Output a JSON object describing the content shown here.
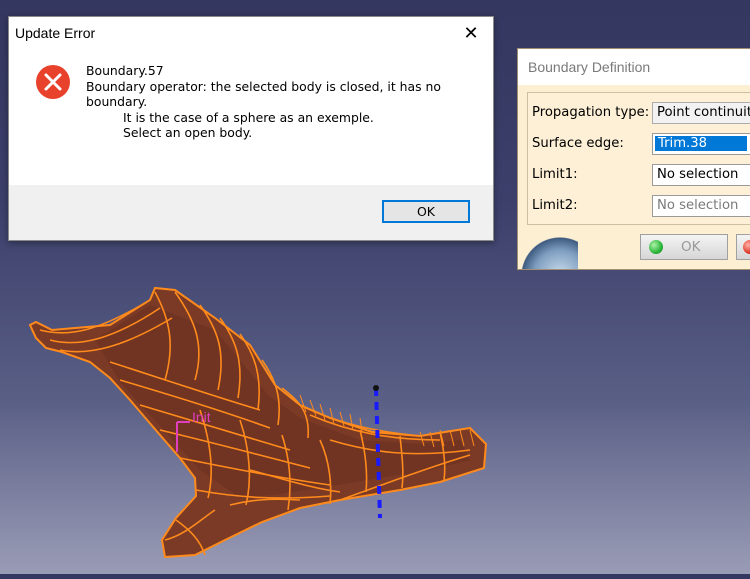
{
  "update_error": {
    "title": "Update Error",
    "message_line1": "Boundary.57",
    "message_line2": "Boundary operator: the selected body is closed, it has no",
    "message_line3": "boundary.",
    "message_line4": "It is the case of a sphere as an exemple.",
    "message_line5": "Select an open body.",
    "ok_label": "OK",
    "close_glyph": "✕",
    "icon": "error-circle-icon",
    "icon_color": "#e8412c"
  },
  "boundary_definition": {
    "title": "Boundary Definition",
    "fields": [
      {
        "label": "Propagation type:",
        "value": "Point continuit"
      },
      {
        "label": "Surface edge:",
        "value": "Trim.38"
      },
      {
        "label": "Limit1:",
        "value": "No selection"
      },
      {
        "label": "Limit2:",
        "value": "No selection"
      }
    ],
    "ok_label": "OK",
    "ok_icon": "green-ball-icon",
    "cancel_icon": "red-ball-icon"
  },
  "viewport": {
    "init_label": "Init",
    "surface_color": "#7d3a24",
    "wire_color": "#ff8a1c",
    "axis_color": "#1a1aff",
    "label_color": "#e040c0"
  }
}
